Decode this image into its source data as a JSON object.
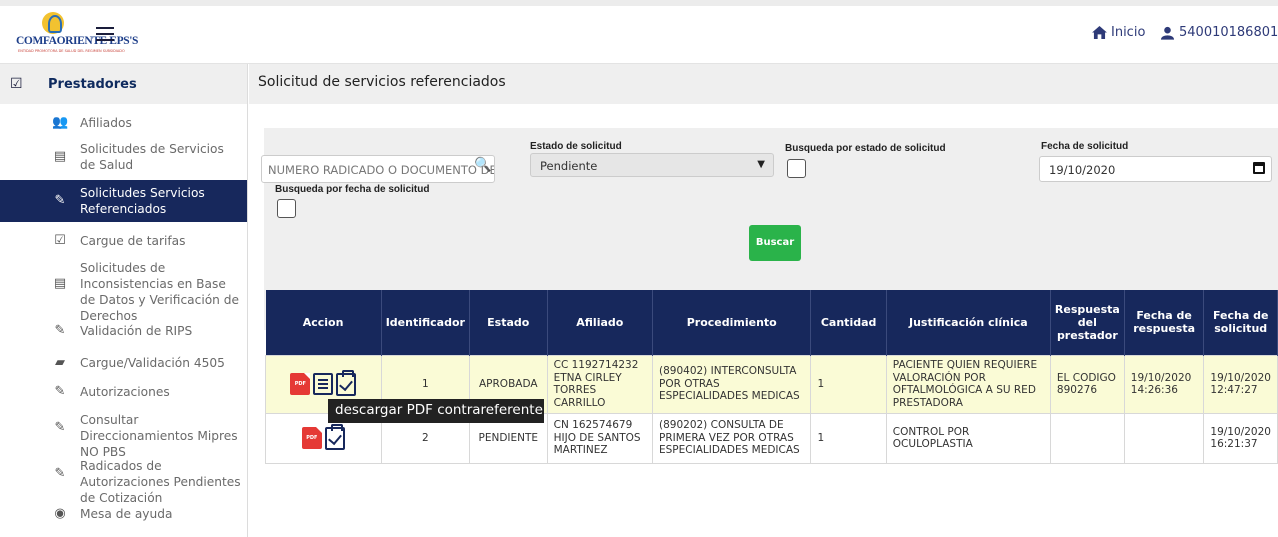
{
  "header": {
    "brand": "COMFAORIENTE EPS'S",
    "brand_sub": "ENTIDAD PROMOTORA DE SALUD DEL REGIMEN SUBSIDIADO",
    "home_label": "Inicio",
    "user_label": "540010186801"
  },
  "sidebar": {
    "title": "Prestadores",
    "items": [
      {
        "label": "Afiliados",
        "icon": "users-icon"
      },
      {
        "label": "Solicitudes de Servicios de Salud",
        "icon": "document-icon"
      },
      {
        "label": "Solicitudes Servicios Referenciados",
        "icon": "edit-list-icon"
      },
      {
        "label": "Cargue de tarifas",
        "icon": "clipboard-check-icon"
      },
      {
        "label": "Solicitudes de Inconsistencias en Base de Datos y Verificación de Derechos",
        "icon": "document-icon"
      },
      {
        "label": "Validación de RIPS",
        "icon": "edit-list-icon"
      },
      {
        "label": "Cargue/Validación 4505",
        "icon": "folder-upload-icon"
      },
      {
        "label": "Autorizaciones",
        "icon": "edit-list-icon"
      },
      {
        "label": "Consultar Direccionamientos Mipres NO PBS",
        "icon": "edit-list-icon"
      },
      {
        "label": "Radicados de Autorizaciones Pendientes de Cotización",
        "icon": "edit-list-icon"
      },
      {
        "label": "Mesa de ayuda",
        "icon": "eye-icon"
      }
    ]
  },
  "page": {
    "title": "Solicitud de servicios referenciados"
  },
  "filters": {
    "search_placeholder": "NUMERO RADICADO O DOCUMENTO DE",
    "estado_label": "Estado de solicitud",
    "estado_value": "Pendiente",
    "busqueda_estado_label": "Busqueda por estado de solicitud",
    "fecha_label": "Fecha de solicitud",
    "fecha_value": "19/10/2020",
    "busqueda_fecha_label": "Busqueda por fecha de solicitud",
    "buscar_label": "Buscar"
  },
  "table": {
    "headers": [
      "Accion",
      "Identificador",
      "Estado",
      "Afiliado",
      "Procedimiento",
      "Cantidad",
      "Justificación clínica",
      "Respuesta del prestador",
      "Fecha de respuesta",
      "Fecha de solicitud"
    ],
    "rows": [
      {
        "id": "1",
        "estado": "APROBADA",
        "afiliado": "CC 1192714232 ETNA CIRLEY TORRES CARRILLO",
        "procedimiento": "(890402) INTERCONSULTA POR OTRAS ESPECIALIDADES MEDICAS",
        "cantidad": "1",
        "justificacion": "PACIENTE QUIEN REQUIERE VALORACIÓN POR OFTALMOLÓGICA A SU RED PRESTADORA",
        "respuesta": "EL CODIGO 890276",
        "fecha_respuesta": "19/10/2020 14:26:36",
        "fecha_solicitud": "19/10/2020 12:47:27"
      },
      {
        "id": "2",
        "estado": "PENDIENTE",
        "afiliado": "CN 162574679 HIJO DE SANTOS MARTINEZ",
        "procedimiento": "(890202) CONSULTA DE PRIMERA VEZ POR OTRAS ESPECIALIDADES MEDICAS",
        "cantidad": "1",
        "justificacion": "CONTROL POR OCULOPLASTIA",
        "respuesta": "",
        "fecha_respuesta": "",
        "fecha_solicitud": "19/10/2020 16:21:37"
      }
    ],
    "pdf_label": "PDF"
  },
  "tooltip": {
    "text": "descargar PDF contrareferente"
  }
}
